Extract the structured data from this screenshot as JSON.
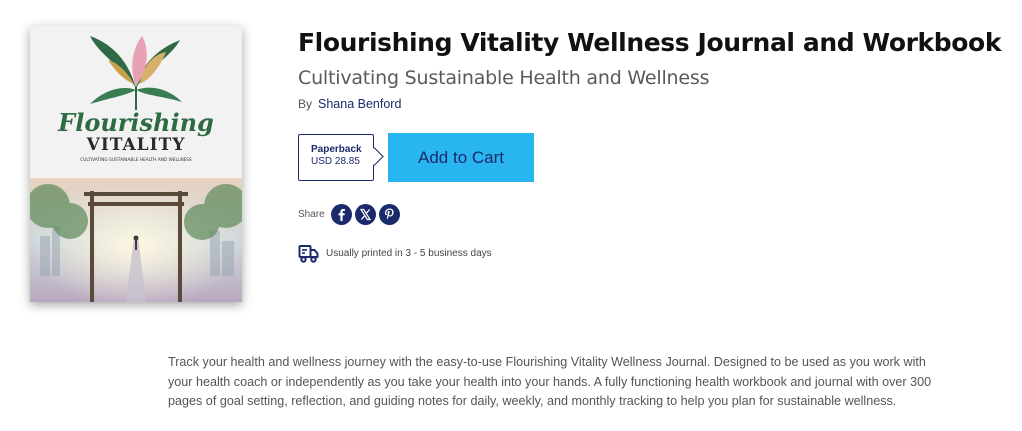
{
  "book": {
    "title": "Flourishing Vitality Wellness Journal and Workbook",
    "subtitle": "Cultivating Sustainable Health and Wellness",
    "by_label": "By",
    "author": "Shana Benford"
  },
  "cover": {
    "title_line1": "Flourishing",
    "title_line2": "VITALITY",
    "tagline": "CULTIVATING SUSTAINABLE HEALTH AND WELLNESS"
  },
  "purchase": {
    "format": "Paperback",
    "price": "USD 28.85",
    "add_to_cart_label": "Add to Cart"
  },
  "share": {
    "label": "Share",
    "icons": [
      "facebook-icon",
      "x-icon",
      "pinterest-icon"
    ]
  },
  "shipping": {
    "icon": "truck-icon",
    "text": "Usually printed in 3 - 5 business days"
  },
  "description": "Track your health and wellness journey with the easy-to-use Flourishing Vitality Wellness Journal. Designed to be used as you work with your health coach or independently as you take your health into your hands. A fully functioning health workbook and journal with over 300 pages of goal setting, reflection, and guiding notes for daily, weekly, and monthly tracking to help you plan for sustainable wellness.",
  "colors": {
    "navy": "#1b2a6b",
    "cart_button": "#29b5ef",
    "cover_green": "#2e6b45"
  }
}
